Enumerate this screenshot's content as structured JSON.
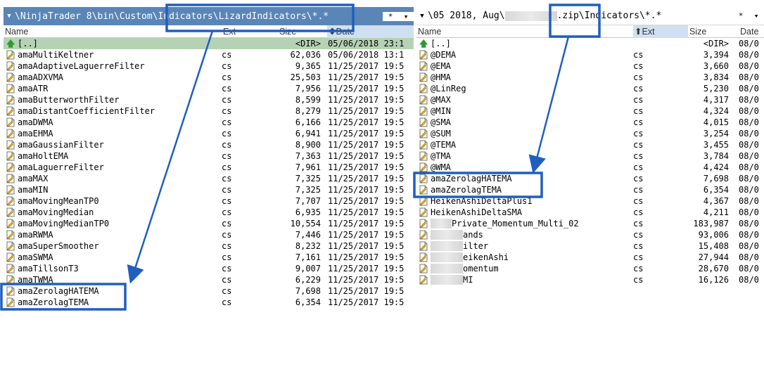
{
  "left_panel": {
    "path": "\\NinjaTrader 8\\bin\\Custom\\Indicators\\LizardIndicators\\*.*",
    "controls": {
      "star": "*",
      "dropdown": "▾"
    },
    "columns": {
      "name": "Name",
      "ext": "Ext",
      "size": "Size",
      "date": "Date",
      "date_sort_arrow": "⬍"
    },
    "updir": {
      "name": "[..]",
      "size": "<DIR>",
      "date": "05/06/2018 23:1"
    },
    "files": [
      {
        "name": "amaMultiKeltner",
        "ext": "cs",
        "size": "62,036",
        "date": "05/06/2018 13:1"
      },
      {
        "name": "amaAdaptiveLaguerreFilter",
        "ext": "cs",
        "size": "9,365",
        "date": "11/25/2017 19:5"
      },
      {
        "name": "amaADXVMA",
        "ext": "cs",
        "size": "25,503",
        "date": "11/25/2017 19:5"
      },
      {
        "name": "amaATR",
        "ext": "cs",
        "size": "7,956",
        "date": "11/25/2017 19:5"
      },
      {
        "name": "amaButterworthFilter",
        "ext": "cs",
        "size": "8,599",
        "date": "11/25/2017 19:5"
      },
      {
        "name": "amaDistantCoefficientFilter",
        "ext": "cs",
        "size": "8,279",
        "date": "11/25/2017 19:5"
      },
      {
        "name": "amaDWMA",
        "ext": "cs",
        "size": "6,166",
        "date": "11/25/2017 19:5"
      },
      {
        "name": "amaEHMA",
        "ext": "cs",
        "size": "6,941",
        "date": "11/25/2017 19:5"
      },
      {
        "name": "amaGaussianFilter",
        "ext": "cs",
        "size": "8,900",
        "date": "11/25/2017 19:5"
      },
      {
        "name": "amaHoltEMA",
        "ext": "cs",
        "size": "7,363",
        "date": "11/25/2017 19:5"
      },
      {
        "name": "amaLaguerreFilter",
        "ext": "cs",
        "size": "7,961",
        "date": "11/25/2017 19:5"
      },
      {
        "name": "amaMAX",
        "ext": "cs",
        "size": "7,325",
        "date": "11/25/2017 19:5"
      },
      {
        "name": "amaMIN",
        "ext": "cs",
        "size": "7,325",
        "date": "11/25/2017 19:5"
      },
      {
        "name": "amaMovingMeanTP0",
        "ext": "cs",
        "size": "7,707",
        "date": "11/25/2017 19:5"
      },
      {
        "name": "amaMovingMedian",
        "ext": "cs",
        "size": "6,935",
        "date": "11/25/2017 19:5"
      },
      {
        "name": "amaMovingMedianTP0",
        "ext": "cs",
        "size": "10,554",
        "date": "11/25/2017 19:5"
      },
      {
        "name": "amaRWMA",
        "ext": "cs",
        "size": "7,446",
        "date": "11/25/2017 19:5"
      },
      {
        "name": "amaSuperSmoother",
        "ext": "cs",
        "size": "8,232",
        "date": "11/25/2017 19:5"
      },
      {
        "name": "amaSWMA",
        "ext": "cs",
        "size": "7,161",
        "date": "11/25/2017 19:5"
      },
      {
        "name": "amaTillsonT3",
        "ext": "cs",
        "size": "9,007",
        "date": "11/25/2017 19:5"
      },
      {
        "name": "amaTWMA",
        "ext": "cs",
        "size": "6,229",
        "date": "11/25/2017 19:5"
      },
      {
        "name": "amaZerolagHATEMA",
        "ext": "cs",
        "size": "7,698",
        "date": "11/25/2017 19:5"
      },
      {
        "name": "amaZerolagTEMA",
        "ext": "cs",
        "size": "6,354",
        "date": "11/25/2017 19:5"
      }
    ]
  },
  "right_panel": {
    "path_prefix": "\\05 2018, Aug\\",
    "path_suffix": ".zip\\Indicators\\*.*",
    "controls": {
      "star": "*",
      "dropdown": "▾"
    },
    "columns": {
      "name": "Name",
      "ext": "Ext",
      "size": "Size",
      "date": "Date",
      "ext_sort_arrow": "⬆"
    },
    "updir": {
      "name": "[..]",
      "size": "<DIR>",
      "date": "08/0"
    },
    "files": [
      {
        "name": "@DEMA",
        "ext": "cs",
        "size": "3,394",
        "date": "08/0"
      },
      {
        "name": "@EMA",
        "ext": "cs",
        "size": "3,660",
        "date": "08/0"
      },
      {
        "name": "@HMA",
        "ext": "cs",
        "size": "3,834",
        "date": "08/0"
      },
      {
        "name": "@LinReg",
        "ext": "cs",
        "size": "5,230",
        "date": "08/0"
      },
      {
        "name": "@MAX",
        "ext": "cs",
        "size": "4,317",
        "date": "08/0"
      },
      {
        "name": "@MIN",
        "ext": "cs",
        "size": "4,324",
        "date": "08/0"
      },
      {
        "name": "@SMA",
        "ext": "cs",
        "size": "4,015",
        "date": "08/0"
      },
      {
        "name": "@SUM",
        "ext": "cs",
        "size": "3,254",
        "date": "08/0"
      },
      {
        "name": "@TEMA",
        "ext": "cs",
        "size": "3,455",
        "date": "08/0"
      },
      {
        "name": "@TMA",
        "ext": "cs",
        "size": "3,784",
        "date": "08/0"
      },
      {
        "name": "@WMA",
        "ext": "cs",
        "size": "4,424",
        "date": "08/0"
      },
      {
        "name": "amaZerolagHATEMA",
        "ext": "cs",
        "size": "7,698",
        "date": "08/0"
      },
      {
        "name": "amaZerolagTEMA",
        "ext": "cs",
        "size": "6,354",
        "date": "08/0"
      },
      {
        "name": "HeikenAshiDeltaPlus1",
        "ext": "cs",
        "size": "4,367",
        "date": "08/0"
      },
      {
        "name": "HeikenAshiDeltaSMA",
        "ext": "cs",
        "size": "4,211",
        "date": "08/0"
      },
      {
        "name": "Private_Momentum_Multi_02",
        "ext": "cs",
        "size": "183,987",
        "date": "08/0",
        "blurred_prefix": true
      },
      {
        "name": "ands",
        "ext": "cs",
        "size": "93,006",
        "date": "08/0",
        "blurred_prefix": true
      },
      {
        "name": "ilter",
        "ext": "cs",
        "size": "15,408",
        "date": "08/0",
        "blurred_prefix": true
      },
      {
        "name": "eikenAshi",
        "ext": "cs",
        "size": "27,944",
        "date": "08/0",
        "blurred_prefix": true
      },
      {
        "name": "omentum",
        "ext": "cs",
        "size": "28,670",
        "date": "08/0",
        "blurred_prefix": true
      },
      {
        "name": "MI",
        "ext": "cs",
        "size": "16,126",
        "date": "08/0",
        "blurred_prefix": true
      }
    ]
  },
  "annotation_color": "#1f5fbf"
}
